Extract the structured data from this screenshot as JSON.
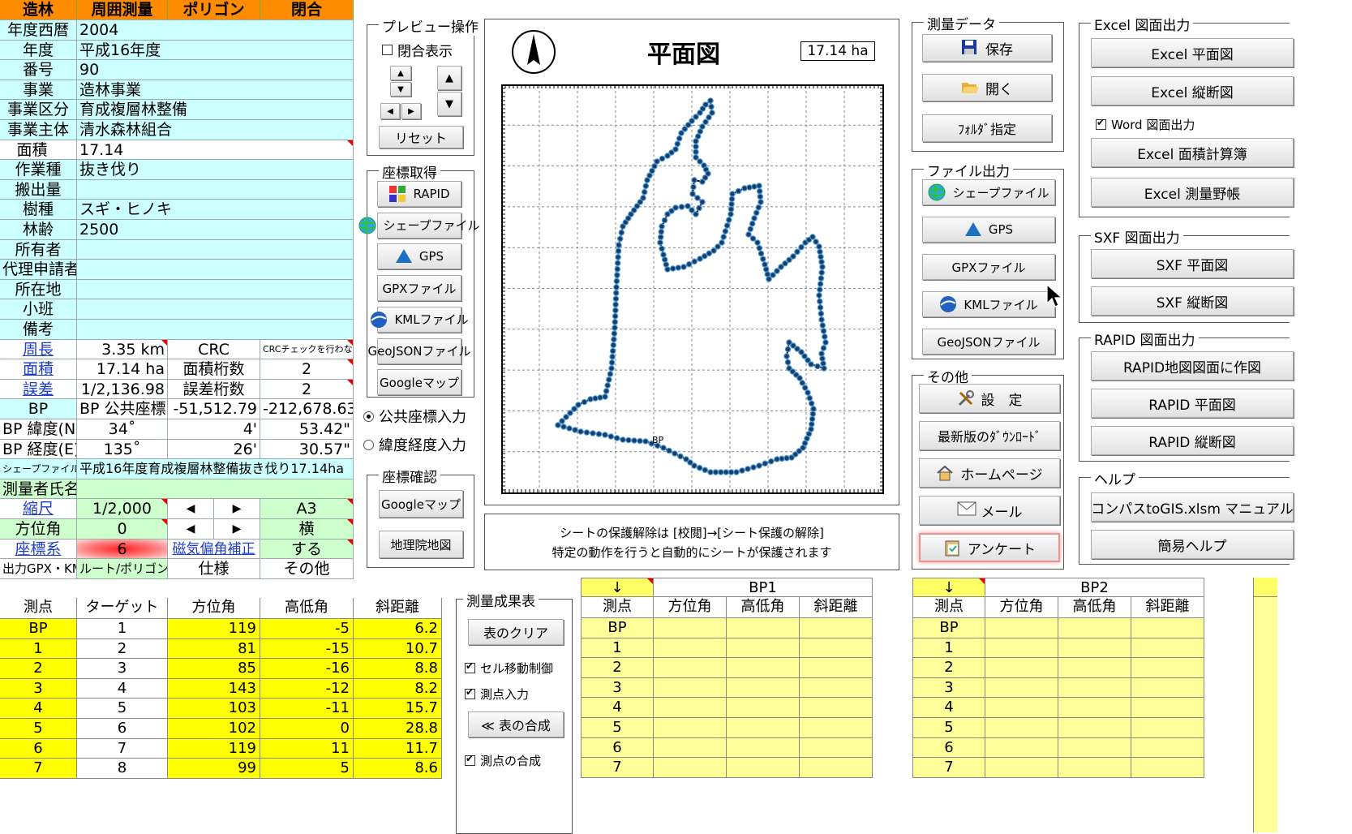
{
  "sheet": {
    "header": [
      "造林",
      "周囲測量",
      "ポリゴン",
      "閉合"
    ],
    "rows": [
      {
        "label": "年度西暦",
        "value": "2004"
      },
      {
        "label": "年度",
        "value": "平成16年度"
      },
      {
        "label": "番号",
        "value": "90"
      },
      {
        "label": "事業",
        "value": "造林事業"
      },
      {
        "label": "事業区分",
        "value": "育成複層林整備"
      },
      {
        "label": "事業主体",
        "value": "清水森林組合"
      },
      {
        "label": "面積",
        "value": "17.14"
      },
      {
        "label": "作業種",
        "value": "抜き伐り"
      },
      {
        "label": "搬出量",
        "value": ""
      },
      {
        "label": "樹種",
        "value": "スギ・ヒノキ"
      },
      {
        "label": "林齢",
        "value": "2500"
      },
      {
        "label": "所有者",
        "value": ""
      },
      {
        "label": "代理申請者",
        "value": ""
      },
      {
        "label": "所在地",
        "value": ""
      },
      {
        "label": "小班",
        "value": ""
      },
      {
        "label": "備考",
        "value": ""
      }
    ],
    "perimeter": {
      "label": "周長",
      "value": "3.35 km",
      "c3": "CRC",
      "c4": "CRCチェックを行わない"
    },
    "area": {
      "label": "面積",
      "value": "17.14 ha",
      "c3": "面積桁数",
      "c4": "2"
    },
    "error": {
      "label": "誤差",
      "value": "1/2,136.98",
      "c3": "誤差桁数",
      "c4": "2"
    },
    "bp": {
      "label": "BP",
      "value": "BP 公共座標",
      "c3": "-51,512.79",
      "c4": "-212,678.63"
    },
    "lat": {
      "label": "BP 緯度(N)",
      "deg": "34˚",
      "min": "4'",
      "sec": "53.42\""
    },
    "lon": {
      "label": "BP 経度(E)",
      "deg": "135˚",
      "min": "26'",
      "sec": "30.57\""
    },
    "shapefile": {
      "label": "シェープファイル名",
      "value": "平成16年度育成複層林整備抜き伐り17.14ha"
    },
    "surveyor": {
      "label": "測量者氏名",
      "value": ""
    },
    "scale": {
      "label": "縮尺",
      "value": "1/2,000",
      "left": "◀",
      "right": "▶",
      "paper": "A3"
    },
    "azimuth": {
      "label": "方位角",
      "value": "0",
      "left": "◀",
      "right": "▶",
      "orient": "横"
    },
    "coord": {
      "label": "座標系",
      "value": "6",
      "c3": "磁気偏角補正",
      "c4": "する"
    },
    "gpx": {
      "label": "出力GPX・KML",
      "value": "ルート/ポリゴン",
      "c3": "仕様",
      "c4": "その他"
    }
  },
  "preview_ops": {
    "title": "プレビュー操作",
    "closure_label": "閉合表示",
    "reset_label": "リセット"
  },
  "coord_get": {
    "title": "座標取得",
    "buttons": [
      {
        "label": "RAPID",
        "icon": "rapid-icon"
      },
      {
        "label": "シェープファイル",
        "icon": "globe-icon"
      },
      {
        "label": "GPS",
        "icon": "gps-triangle-icon"
      },
      {
        "label": "GPXファイル",
        "icon": ""
      },
      {
        "label": "KMLファイル",
        "icon": "kml-globe-icon"
      },
      {
        "label": "GeoJSONファイル",
        "icon": ""
      },
      {
        "label": "Googleマップ",
        "icon": ""
      }
    ]
  },
  "input_mode": {
    "public": "公共座標入力",
    "latlon": "緯度経度入力"
  },
  "coord_check": {
    "title": "座標確認",
    "google": "Googleマップ",
    "gsi": "地理院地図"
  },
  "plan": {
    "title": "平面図",
    "area": "17.14 ha",
    "bp_label": "BP",
    "north": "north-arrow-icon"
  },
  "notice": {
    "line1": "シートの保護解除は [校閲]→[シート保護の解除]",
    "line2": "特定の動作を行うと自動的にシートが保護されます"
  },
  "survey_data": {
    "title": "測量データ",
    "save": "保存",
    "open": "開く",
    "folder": "ﾌｫﾙﾀﾞ指定"
  },
  "file_out": {
    "title": "ファイル出力",
    "buttons": [
      {
        "label": "シェープファイル",
        "icon": "globe-icon"
      },
      {
        "label": "GPS",
        "icon": "gps-triangle-icon"
      },
      {
        "label": "GPXファイル",
        "icon": ""
      },
      {
        "label": "KMLファイル",
        "icon": "kml-globe-icon"
      },
      {
        "label": "GeoJSONファイル",
        "icon": ""
      }
    ]
  },
  "other": {
    "title": "その他",
    "settings": "設　定",
    "download": "最新版のﾀﾞｳﾝﾛｰﾄﾞ",
    "home": "ホームページ",
    "mail": "メール",
    "survey": "アンケート"
  },
  "excel_out": {
    "title": "Excel 図面出力",
    "plan": "Excel 平面図",
    "profile": "Excel 縦断図",
    "word_label": "Word 図面出力",
    "area_calc": "Excel 面積計算簿",
    "field_book": "Excel 測量野帳"
  },
  "sxf_out": {
    "title": "SXF 図面出力",
    "plan": "SXF 平面図",
    "profile": "SXF 縦断図"
  },
  "rapid_out": {
    "title": "RAPID 図面出力",
    "create": "RAPID地図図面に作図",
    "plan": "RAPID 平面図",
    "profile": "RAPID 縦断図"
  },
  "help": {
    "title": "ヘルプ",
    "manual": "コンパスtoGIS.xlsm マニュアル",
    "simple": "簡易ヘルプ"
  },
  "results": {
    "title": "測量成果表",
    "clear": "表のクリア",
    "cell_move": "セル移動制御",
    "point_input": "測点入力",
    "combine": "≪ 表の合成",
    "point_combine": "測点の合成"
  },
  "main_table": {
    "headers": [
      "測点",
      "ターゲット",
      "方位角",
      "高低角",
      "斜距離"
    ],
    "rows": [
      [
        "BP",
        "1",
        "119",
        "-5",
        "6.2"
      ],
      [
        "1",
        "2",
        "81",
        "-15",
        "10.7"
      ],
      [
        "2",
        "3",
        "85",
        "-16",
        "8.8"
      ],
      [
        "3",
        "4",
        "143",
        "-12",
        "8.2"
      ],
      [
        "4",
        "5",
        "103",
        "-11",
        "15.7"
      ],
      [
        "5",
        "6",
        "102",
        "0",
        "28.8"
      ],
      [
        "6",
        "7",
        "119",
        "11",
        "11.7"
      ],
      [
        "7",
        "8",
        "99",
        "5",
        "8.6"
      ]
    ]
  },
  "bp1_table": {
    "arrow": "↓",
    "title": "BP1",
    "headers": [
      "測点",
      "方位角",
      "高低角",
      "斜距離"
    ],
    "points": [
      "BP",
      "1",
      "2",
      "3",
      "4",
      "5",
      "6",
      "7"
    ]
  },
  "bp2_table": {
    "arrow": "↓",
    "title": "BP2",
    "headers": [
      "測点",
      "方位角",
      "高低角",
      "斜距離"
    ],
    "points": [
      "BP",
      "1",
      "2",
      "3",
      "4",
      "5",
      "6",
      "7"
    ]
  }
}
